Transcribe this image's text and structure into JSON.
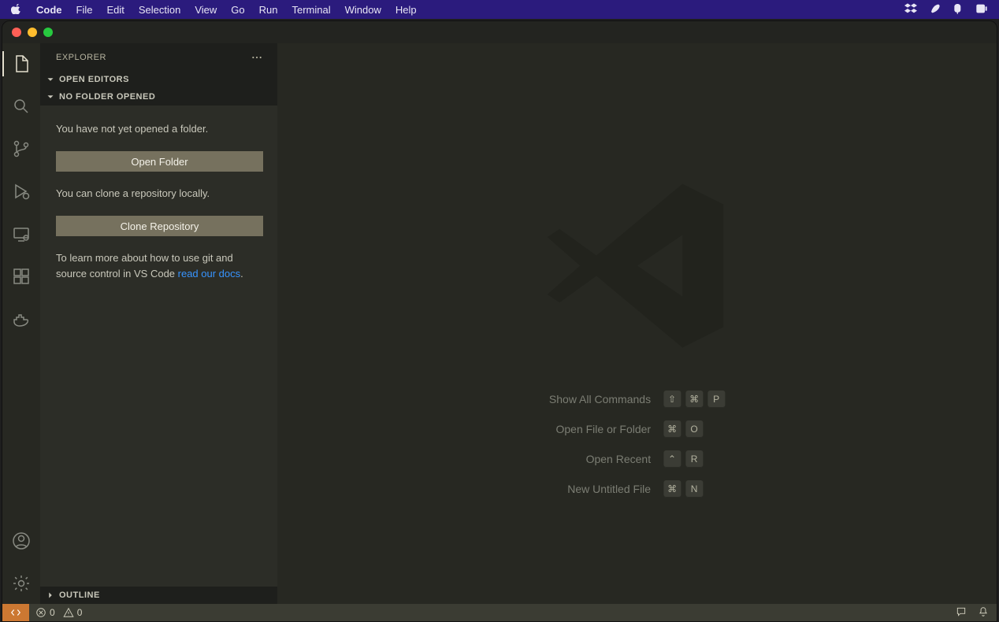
{
  "macmenu": {
    "appname": "Code",
    "items": [
      "File",
      "Edit",
      "Selection",
      "View",
      "Go",
      "Run",
      "Terminal",
      "Window",
      "Help"
    ]
  },
  "sidebar": {
    "title": "EXPLORER",
    "open_editors": "OPEN EDITORS",
    "no_folder": "NO FOLDER OPENED",
    "outline": "OUTLINE",
    "msg_no_folder": "You have not yet opened a folder.",
    "btn_open_folder": "Open Folder",
    "msg_clone": "You can clone a repository locally.",
    "btn_clone": "Clone Repository",
    "msg_docs_1": "To learn more about how to use git and source control in VS Code ",
    "link_docs": "read our docs",
    "msg_docs_2": "."
  },
  "shortcuts": [
    {
      "label": "Show All Commands",
      "keys": [
        "⇧",
        "⌘",
        "P"
      ]
    },
    {
      "label": "Open File or Folder",
      "keys": [
        "⌘",
        "O"
      ]
    },
    {
      "label": "Open Recent",
      "keys": [
        "⌃",
        "R"
      ]
    },
    {
      "label": "New Untitled File",
      "keys": [
        "⌘",
        "N"
      ]
    }
  ],
  "statusbar": {
    "errors": "0",
    "warnings": "0"
  }
}
